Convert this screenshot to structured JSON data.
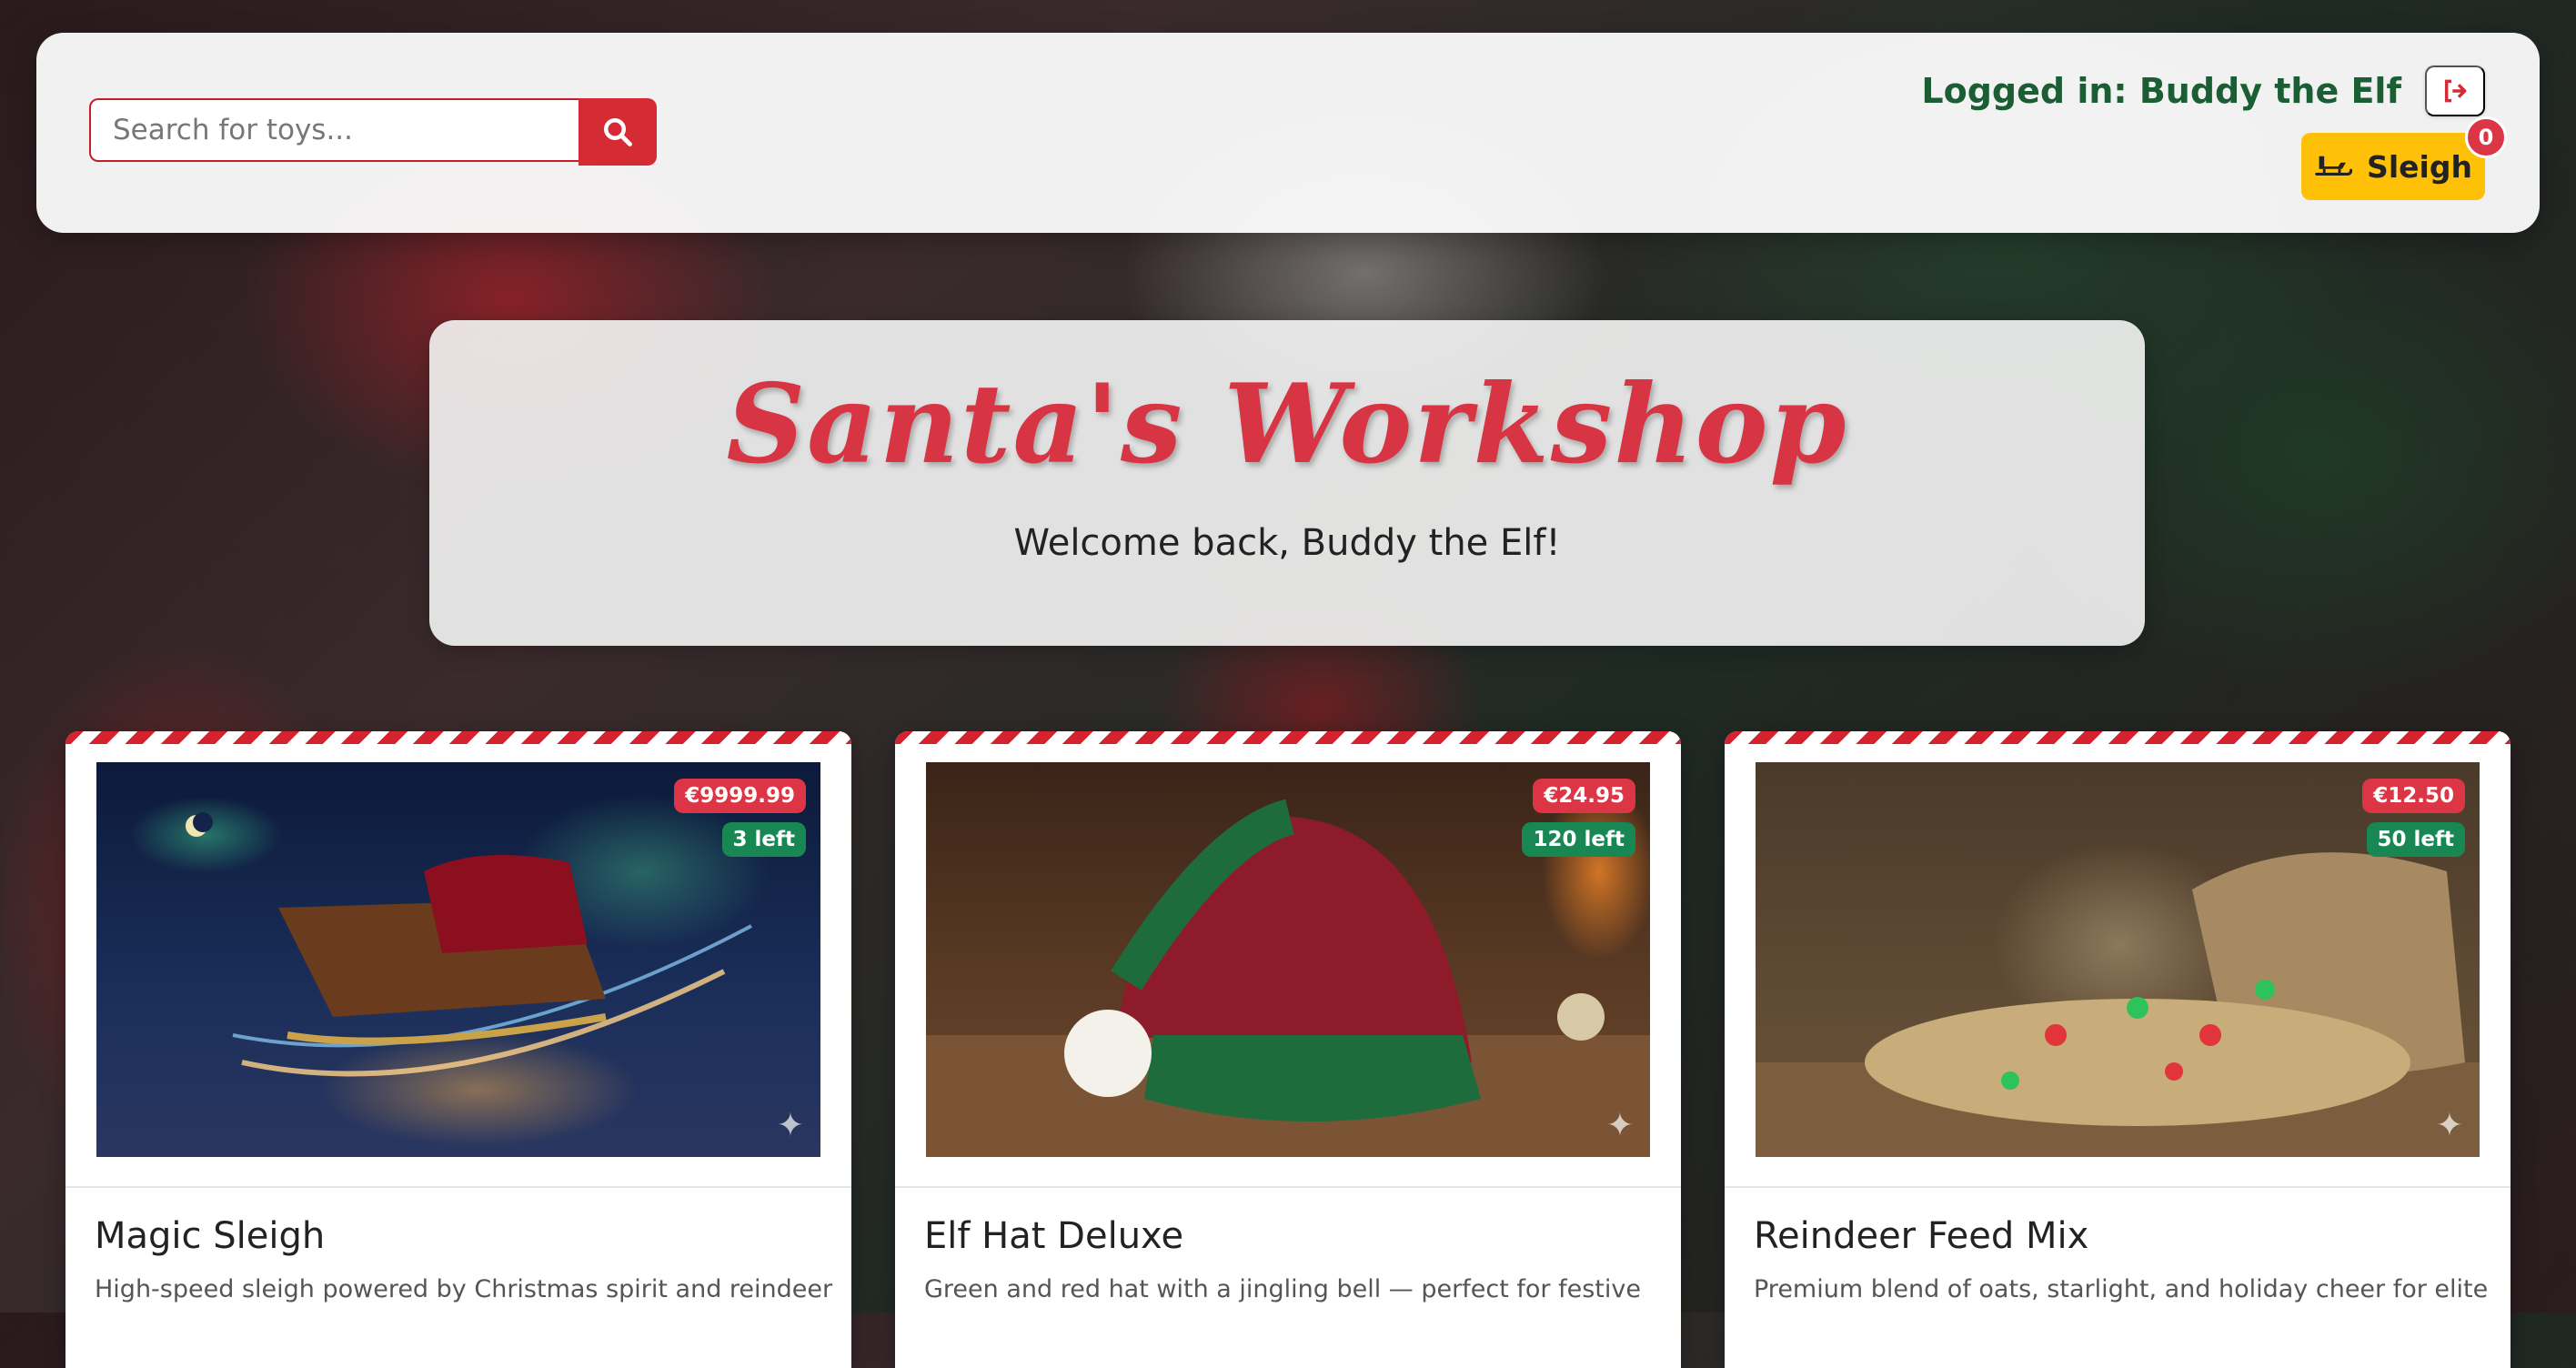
{
  "header": {
    "search": {
      "placeholder": "Search for toys...",
      "value": ""
    },
    "user_label": "Logged in: Buddy the Elf",
    "cart_label": "Sleigh",
    "cart_count": "0"
  },
  "hero": {
    "title": "Santa's Workshop",
    "subtitle": "Welcome back, Buddy the Elf!"
  },
  "products": [
    {
      "name": "Magic Sleigh",
      "price": "€9999.99",
      "stock": "3 left",
      "description": "High-speed sleigh powered by Christmas spirit and reindeer"
    },
    {
      "name": "Elf Hat Deluxe",
      "price": "€24.95",
      "stock": "120 left",
      "description": "Green and red hat with a jingling bell — perfect for festive"
    },
    {
      "name": "Reindeer Feed Mix",
      "price": "€12.50",
      "stock": "50 left",
      "description": "Premium blend of oats, starlight, and holiday cheer for elite"
    }
  ],
  "colors": {
    "brand_red": "#d52b34",
    "user_green": "#1b5e33",
    "cart_yellow": "#ffc107",
    "stock_green": "#198754"
  }
}
